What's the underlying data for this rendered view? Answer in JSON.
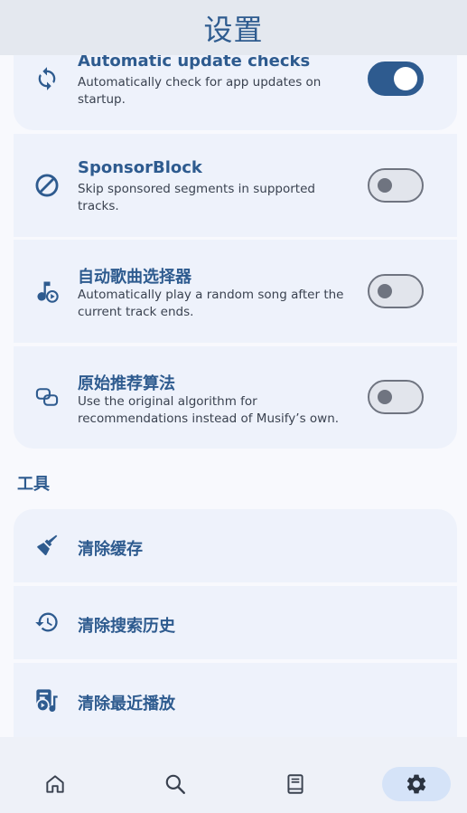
{
  "header": {
    "title": "设置"
  },
  "settings": [
    {
      "icon": "sync-icon",
      "title": "Automatic update checks",
      "subtitle": "Automatically check for app updates on startup.",
      "enabled": true
    },
    {
      "icon": "block-icon",
      "title": "SponsorBlock",
      "subtitle": "Skip sponsored segments in supported tracks.",
      "enabled": false
    },
    {
      "icon": "music-play-icon",
      "title": "自动歌曲选择器",
      "subtitle": "Automatically play a random song after the current track ends.",
      "enabled": false
    },
    {
      "icon": "link-icon",
      "title": "原始推荐算法",
      "subtitle": "Use the original algorithm for recommendations instead of Musify’s own.",
      "enabled": false
    }
  ],
  "tools": {
    "section_label": "工具",
    "items": [
      {
        "icon": "broom-icon",
        "title": "清除缓存"
      },
      {
        "icon": "history-icon",
        "title": "清除搜索历史"
      },
      {
        "icon": "library-music-icon",
        "title": "清除最近播放"
      }
    ]
  },
  "nav": {
    "items": [
      {
        "icon": "home-icon",
        "active": false
      },
      {
        "icon": "search-icon",
        "active": false
      },
      {
        "icon": "library-icon",
        "active": false
      },
      {
        "icon": "settings-icon",
        "active": true
      }
    ]
  },
  "colors": {
    "accent": "#2e5b8f",
    "card": "#eef2fb",
    "appbar": "#e4e8ef",
    "active_pill": "#d5e3f8"
  }
}
